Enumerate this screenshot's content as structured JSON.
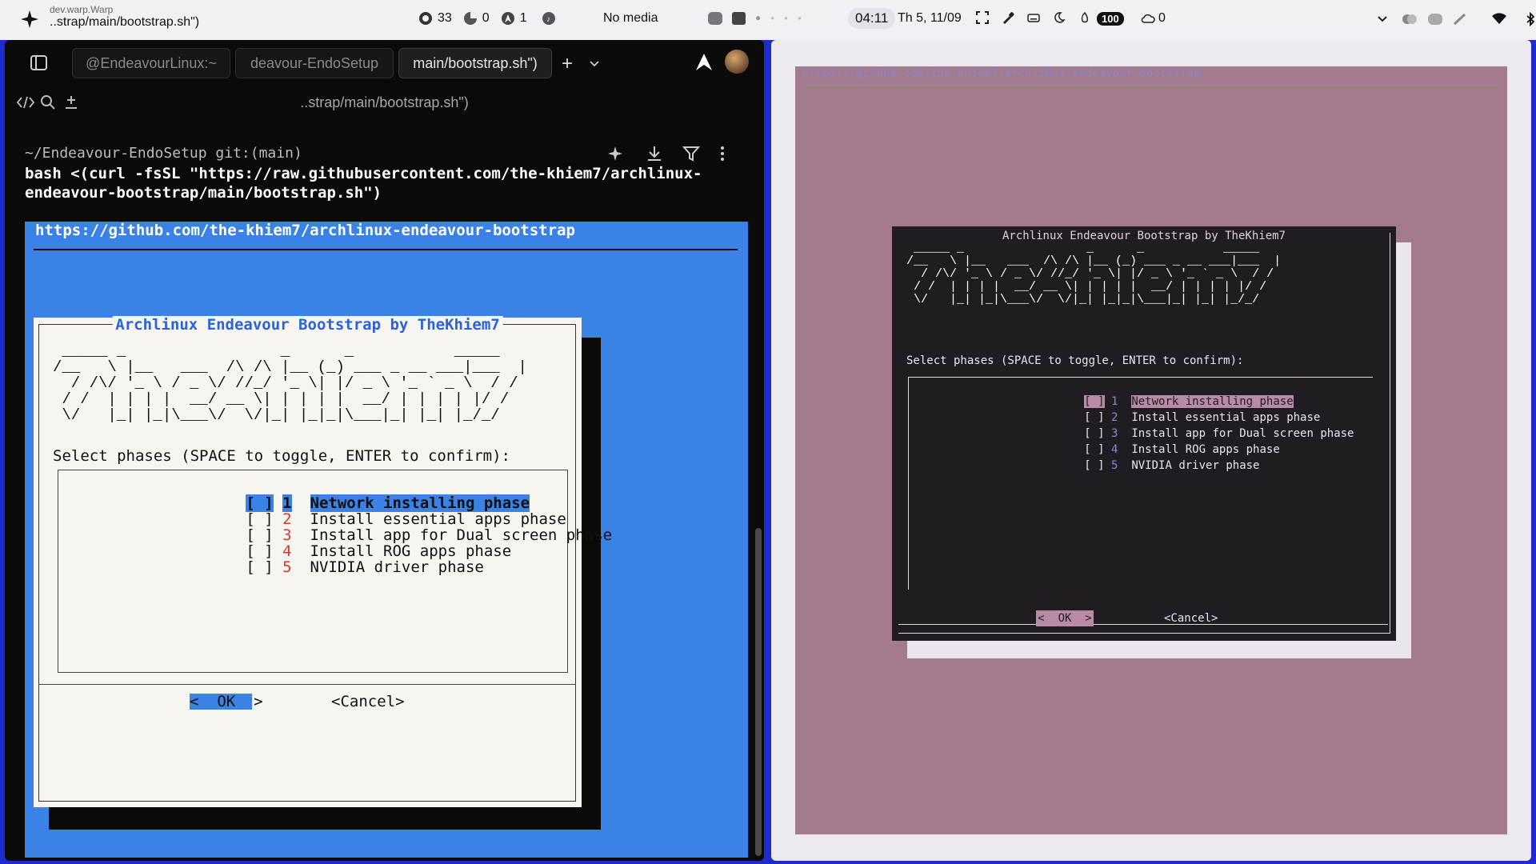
{
  "topbar": {
    "app_id": "dev.warp.Warp",
    "window_title": "..strap/main/bootstrap.sh\")",
    "cpu": "33",
    "mem": "0",
    "net": "1",
    "media": "No media",
    "time": "04:11",
    "date": "Th 5, 11/09",
    "battery": "100",
    "cloud": "0"
  },
  "warp": {
    "tabs": [
      "@EndeavourLinux:~",
      "deavour-EndoSetup",
      "main/bootstrap.sh\")"
    ],
    "pane_title": "..strap/main/bootstrap.sh\")",
    "prompt_dir": "~/Endeavour-EndoSetup git:(main)",
    "command": "bash <(curl -fsSL \"https://raw.githubusercontent.com/the-khiem7/archlinux-\nendeavour-bootstrap/main/bootstrap.sh\")"
  },
  "dialog": {
    "url": "https://github.com/the-khiem7/archlinux-endeavour-bootstrap",
    "title": "Archlinux Endeavour Bootstrap by TheKhiem7",
    "ascii": " _____ _                 _      _           _____ \n/__   \\ |__   ___  /\\ /\\ |__ (_) ___ _ __ ___|___  |\n  / /\\/ '_ \\ / _ \\/ //_/ '_ \\| |/ _ \\ '_ ` _ \\  / /\n / /  | | | |  __/ __ \\| | | | |  __/ | | | | |/ / \n \\/   |_| |_|\\___\\/  \\/|_| |_|_|\\___|_| |_| |_/_/  ",
    "select_label": "Select phases (SPACE to toggle, ENTER to confirm):",
    "items": [
      {
        "checkbox": "[ ]",
        "num": "1",
        "label": "Network installing phase"
      },
      {
        "checkbox": "[ ]",
        "num": "2",
        "label": "Install essential apps phase"
      },
      {
        "checkbox": "[ ]",
        "num": "3",
        "label": "Install app for Dual screen phase"
      },
      {
        "checkbox": "[ ]",
        "num": "4",
        "label": "Install ROG apps phase"
      },
      {
        "checkbox": "[ ]",
        "num": "5",
        "label": "NVIDIA driver phase"
      }
    ],
    "ok": "<  OK  >",
    "cancel": "<Cancel>"
  },
  "colors": {
    "desktop": "#1d2bd1",
    "left_term_bg": "#3a82e6",
    "right_term_bg": "#a47a8e",
    "right_dialog_bg": "#1f1d22"
  }
}
